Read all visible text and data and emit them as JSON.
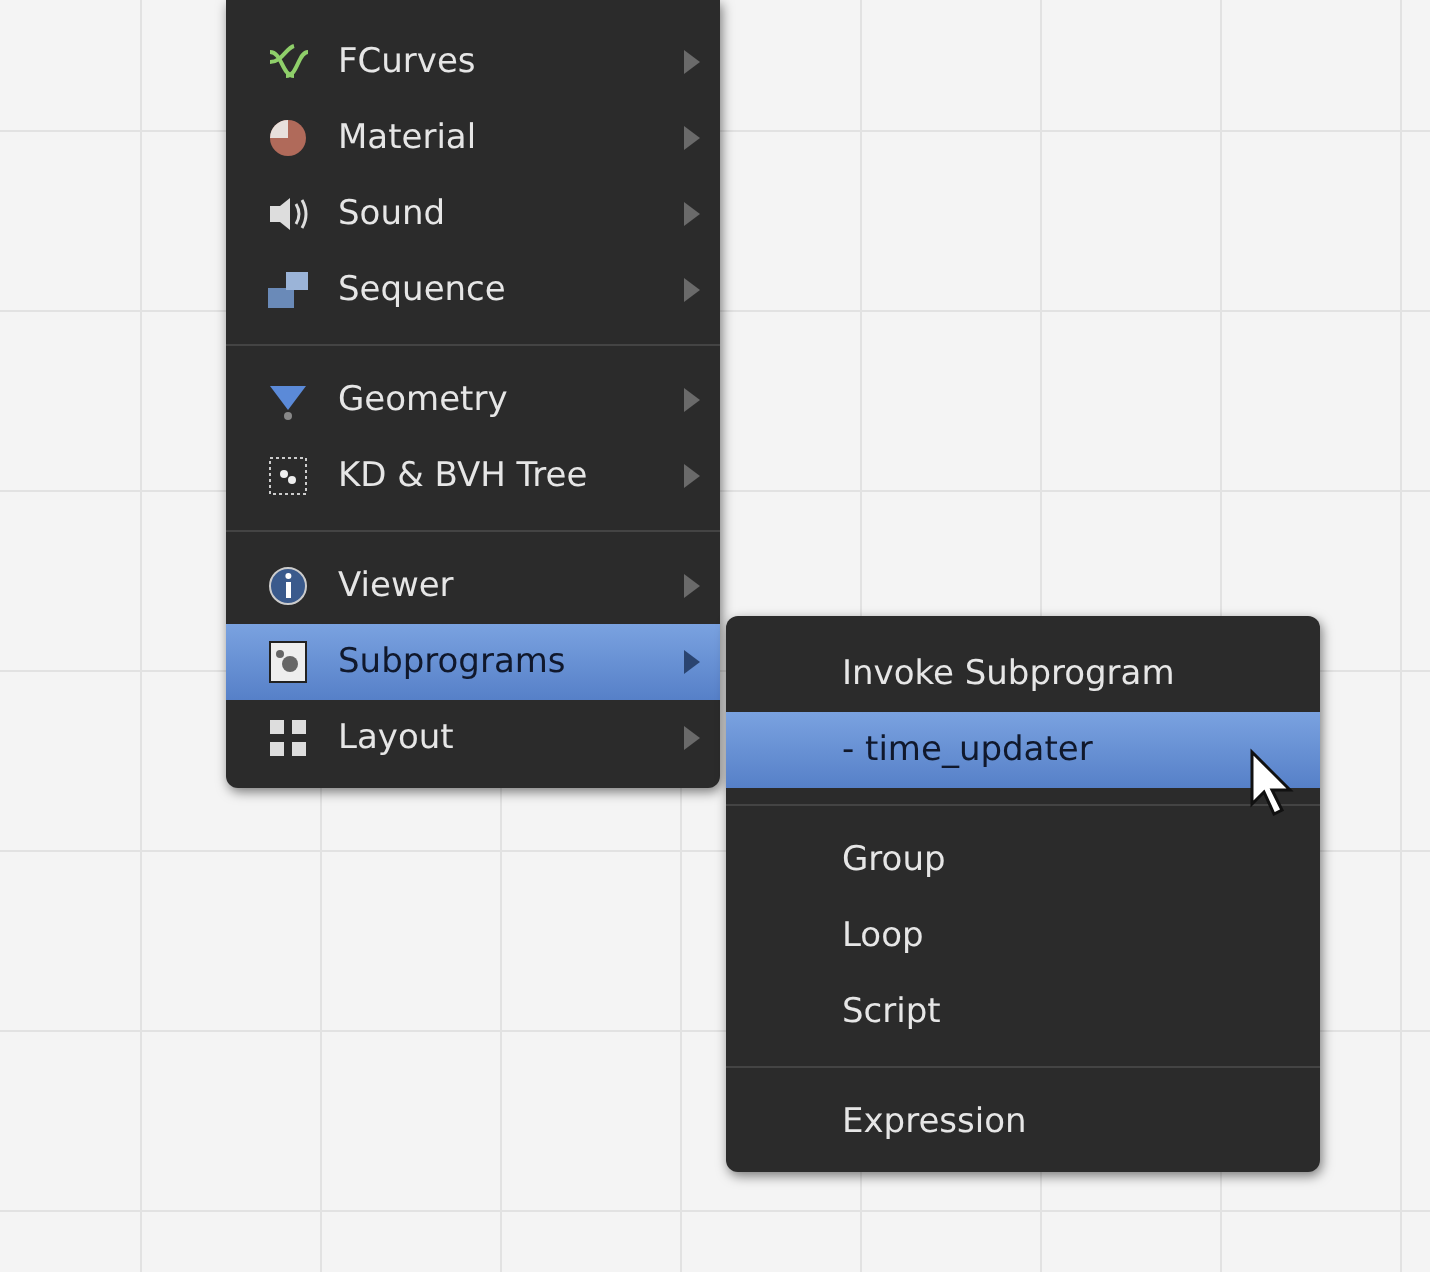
{
  "main_menu": {
    "sections": [
      {
        "items": [
          {
            "label": "FCurves",
            "selected": false
          },
          {
            "label": "Material",
            "selected": false
          },
          {
            "label": "Sound",
            "selected": false
          },
          {
            "label": "Sequence",
            "selected": false
          }
        ]
      },
      {
        "items": [
          {
            "label": "Geometry",
            "selected": false
          },
          {
            "label": "KD & BVH Tree",
            "selected": false
          }
        ]
      },
      {
        "items": [
          {
            "label": "Viewer",
            "selected": false
          },
          {
            "label": "Subprograms",
            "selected": true
          },
          {
            "label": "Layout",
            "selected": false
          }
        ]
      }
    ]
  },
  "submenu": {
    "sections": [
      {
        "items": [
          {
            "label": "Invoke Subprogram",
            "selected": false
          },
          {
            "label": "- time_updater",
            "selected": true
          }
        ]
      },
      {
        "items": [
          {
            "label": "Group",
            "selected": false
          },
          {
            "label": "Loop",
            "selected": false
          },
          {
            "label": "Script",
            "selected": false
          }
        ]
      },
      {
        "items": [
          {
            "label": "Expression",
            "selected": false
          }
        ]
      }
    ]
  }
}
